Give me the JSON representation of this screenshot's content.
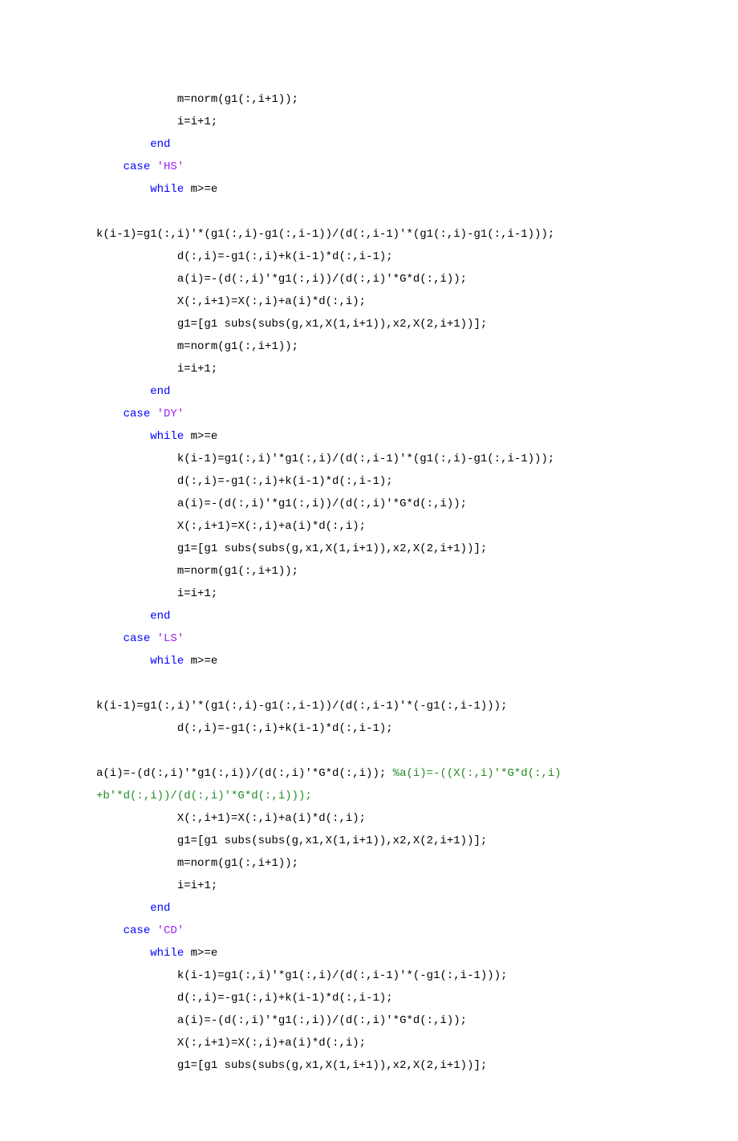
{
  "lines": [
    {
      "indent": 12,
      "segs": [
        {
          "t": "m=norm(g1(:,i+1));"
        }
      ]
    },
    {
      "indent": 12,
      "segs": [
        {
          "t": "i=i+1;"
        }
      ]
    },
    {
      "indent": 8,
      "segs": [
        {
          "t": "end",
          "c": "keyword"
        }
      ]
    },
    {
      "indent": 4,
      "segs": [
        {
          "t": "case ",
          "c": "keyword"
        },
        {
          "t": "'HS'",
          "c": "string"
        }
      ]
    },
    {
      "indent": 8,
      "segs": [
        {
          "t": "while ",
          "c": "keyword"
        },
        {
          "t": "m>=e"
        }
      ]
    },
    {
      "blank": true
    },
    {
      "indent": 0,
      "segs": [
        {
          "t": "k(i-1)=g1(:,i)'*(g1(:,i)-g1(:,i-1))/(d(:,i-1)'*(g1(:,i)-g1(:,i-1)));"
        }
      ]
    },
    {
      "indent": 12,
      "segs": [
        {
          "t": "d(:,i)=-g1(:,i)+k(i-1)*d(:,i-1);"
        }
      ]
    },
    {
      "indent": 12,
      "segs": [
        {
          "t": "a(i)=-(d(:,i)'*g1(:,i))/(d(:,i)'*G*d(:,i));"
        }
      ]
    },
    {
      "indent": 12,
      "segs": [
        {
          "t": "X(:,i+1)=X(:,i)+a(i)*d(:,i);"
        }
      ]
    },
    {
      "indent": 12,
      "segs": [
        {
          "t": "g1=[g1 subs(subs(g,x1,X(1,i+1)),x2,X(2,i+1))];"
        }
      ]
    },
    {
      "indent": 12,
      "segs": [
        {
          "t": "m=norm(g1(:,i+1));"
        }
      ]
    },
    {
      "indent": 12,
      "segs": [
        {
          "t": "i=i+1;"
        }
      ]
    },
    {
      "indent": 8,
      "segs": [
        {
          "t": "end",
          "c": "keyword"
        }
      ]
    },
    {
      "indent": 4,
      "segs": [
        {
          "t": "case ",
          "c": "keyword"
        },
        {
          "t": "'DY'",
          "c": "string"
        }
      ]
    },
    {
      "indent": 8,
      "segs": [
        {
          "t": "while ",
          "c": "keyword"
        },
        {
          "t": "m>=e"
        }
      ]
    },
    {
      "indent": 12,
      "segs": [
        {
          "t": "k(i-1)=g1(:,i)'*g1(:,i)/(d(:,i-1)'*(g1(:,i)-g1(:,i-1)));"
        }
      ]
    },
    {
      "indent": 12,
      "segs": [
        {
          "t": "d(:,i)=-g1(:,i)+k(i-1)*d(:,i-1);"
        }
      ]
    },
    {
      "indent": 12,
      "segs": [
        {
          "t": "a(i)=-(d(:,i)'*g1(:,i))/(d(:,i)'*G*d(:,i));"
        }
      ]
    },
    {
      "indent": 12,
      "segs": [
        {
          "t": "X(:,i+1)=X(:,i)+a(i)*d(:,i);"
        }
      ]
    },
    {
      "indent": 12,
      "segs": [
        {
          "t": "g1=[g1 subs(subs(g,x1,X(1,i+1)),x2,X(2,i+1))];"
        }
      ]
    },
    {
      "indent": 12,
      "segs": [
        {
          "t": "m=norm(g1(:,i+1));"
        }
      ]
    },
    {
      "indent": 12,
      "segs": [
        {
          "t": "i=i+1;"
        }
      ]
    },
    {
      "indent": 8,
      "segs": [
        {
          "t": "end",
          "c": "keyword"
        }
      ]
    },
    {
      "indent": 4,
      "segs": [
        {
          "t": "case ",
          "c": "keyword"
        },
        {
          "t": "'LS'",
          "c": "string"
        }
      ]
    },
    {
      "indent": 8,
      "segs": [
        {
          "t": "while ",
          "c": "keyword"
        },
        {
          "t": "m>=e"
        }
      ]
    },
    {
      "blank": true
    },
    {
      "indent": 0,
      "segs": [
        {
          "t": "k(i-1)=g1(:,i)'*(g1(:,i)-g1(:,i-1))/(d(:,i-1)'*(-g1(:,i-1)));"
        }
      ]
    },
    {
      "indent": 12,
      "segs": [
        {
          "t": "d(:,i)=-g1(:,i)+k(i-1)*d(:,i-1);"
        }
      ]
    },
    {
      "blank": true
    },
    {
      "indent": 0,
      "segs": [
        {
          "t": "a(i)=-(d(:,i)'*g1(:,i))/(d(:,i)'*G*d(:,i)); "
        },
        {
          "t": "%a(i)=-((X(:,i)'*G*d(:,i)",
          "c": "comment"
        }
      ]
    },
    {
      "indent": 0,
      "segs": [
        {
          "t": "+b'*d(:,i))/(d(:,i)'*G*d(:,i)));",
          "c": "comment"
        }
      ]
    },
    {
      "indent": 12,
      "segs": [
        {
          "t": "X(:,i+1)=X(:,i)+a(i)*d(:,i);"
        }
      ]
    },
    {
      "indent": 12,
      "segs": [
        {
          "t": "g1=[g1 subs(subs(g,x1,X(1,i+1)),x2,X(2,i+1))];"
        }
      ]
    },
    {
      "indent": 12,
      "segs": [
        {
          "t": "m=norm(g1(:,i+1));"
        }
      ]
    },
    {
      "indent": 12,
      "segs": [
        {
          "t": "i=i+1;"
        }
      ]
    },
    {
      "indent": 8,
      "segs": [
        {
          "t": "end",
          "c": "keyword"
        }
      ]
    },
    {
      "indent": 4,
      "segs": [
        {
          "t": "case ",
          "c": "keyword"
        },
        {
          "t": "'CD'",
          "c": "string"
        }
      ]
    },
    {
      "indent": 8,
      "segs": [
        {
          "t": "while ",
          "c": "keyword"
        },
        {
          "t": "m>=e"
        }
      ]
    },
    {
      "indent": 12,
      "segs": [
        {
          "t": "k(i-1)=g1(:,i)'*g1(:,i)/(d(:,i-1)'*(-g1(:,i-1)));"
        }
      ]
    },
    {
      "indent": 12,
      "segs": [
        {
          "t": "d(:,i)=-g1(:,i)+k(i-1)*d(:,i-1);"
        }
      ]
    },
    {
      "indent": 12,
      "segs": [
        {
          "t": "a(i)=-(d(:,i)'*g1(:,i))/(d(:,i)'*G*d(:,i));"
        }
      ]
    },
    {
      "indent": 12,
      "segs": [
        {
          "t": "X(:,i+1)=X(:,i)+a(i)*d(:,i);"
        }
      ]
    },
    {
      "indent": 12,
      "segs": [
        {
          "t": "g1=[g1 subs(subs(g,x1,X(1,i+1)),x2,X(2,i+1))];"
        }
      ]
    }
  ]
}
